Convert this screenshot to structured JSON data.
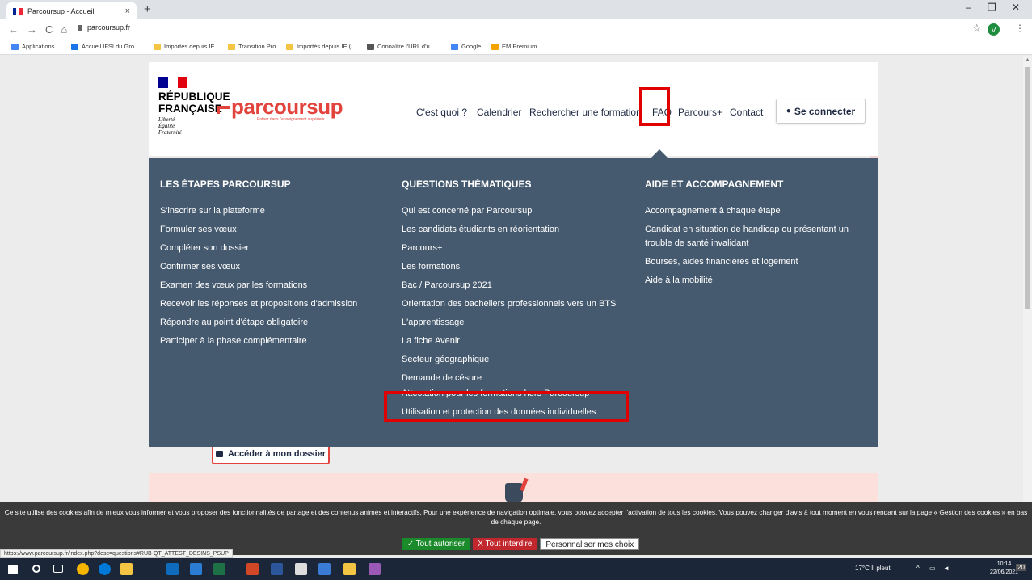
{
  "browser": {
    "tab_title": "Parcoursup - Accueil",
    "tab_close": "×",
    "new_tab": "+",
    "url": "parcoursup.fr",
    "avatar_initial": "V",
    "window_controls": [
      "–",
      "❐",
      "✕"
    ],
    "bookmarks": [
      "Applications",
      "Accueil IFSI du Gro...",
      "Importés depuis IE",
      "Transition Pro",
      "Importés depuis IE (...",
      "Connaître l'URL d'u...",
      "Google",
      "EM Premium"
    ],
    "bookmark_colors": [
      "#4285f4",
      "#1a73e8",
      "#f4c542",
      "#f4c542",
      "#f4c542",
      "#555555",
      "#4285f4",
      "#f4a300"
    ],
    "status_url": "https://www.parcoursup.fr/index.php?desc=questions#RUB-QT_ATTEST_DESINS_PSUP"
  },
  "header": {
    "rf_line1": "RÉPUBLIQUE",
    "rf_line2": "FRANÇAISE",
    "motto": [
      "Liberté",
      "Égalité",
      "Fraternité"
    ],
    "logo_text": "parcoursup",
    "logo_tagline": "Entrez dans l'enseignement supérieur",
    "nav": [
      "C'est quoi ?",
      "Calendrier",
      "Rechercher une formation",
      "FAQ",
      "Parcours+",
      "Contact"
    ],
    "connect_label": "Se connecter"
  },
  "mega_menu": {
    "columns": [
      {
        "title": "LES ÉTAPES PARCOURSUP",
        "links": [
          "S'inscrire sur la plateforme",
          "Formuler ses vœux",
          "Compléter son dossier",
          "Confirmer ses vœux",
          "Examen des vœux par les formations",
          "Recevoir les réponses et propositions d'admission",
          "Répondre au point d'étape obligatoire",
          "Participer à la phase complémentaire"
        ]
      },
      {
        "title": "QUESTIONS THÉMATIQUES",
        "links": [
          "Qui est concerné par Parcoursup",
          "Les candidats étudiants en réorientation",
          "Parcours+",
          "Les formations",
          "Bac / Parcoursup 2021",
          "Orientation des bacheliers professionnels vers un BTS",
          "L'apprentissage",
          "La fiche Avenir",
          "Secteur géographique",
          "Demande de césure",
          "Attestation pour les formations hors Parcoursup",
          "Utilisation et protection des données individuelles"
        ]
      },
      {
        "title": "AIDE ET ACCOMPAGNEMENT",
        "links": [
          "Accompagnement à chaque étape",
          "Candidat en situation de handicap ou présentant un trouble de santé invalidant",
          "Bourses, aides financières et logement",
          "Aide à la mobilité"
        ]
      }
    ]
  },
  "page": {
    "access_button": "Accéder à mon dossier"
  },
  "cookie": {
    "text": "Ce site utilise des cookies afin de mieux vous informer et vous proposer des fonctionnalités de partage et des contenus animés et interactifs. Pour une expérience de navigation optimale, vous pouvez accepter l'activation de tous les cookies. Vous pouvez changer d'avis à tout moment en vous rendant sur la page « Gestion des cookies » en bas de chaque page.",
    "accept": "✓ Tout autoriser",
    "deny": "X Tout interdire",
    "customize": "Personnaliser mes choix"
  },
  "taskbar": {
    "weather": "17°C Il pleut",
    "time": "10:14",
    "date": "22/06/2021",
    "notifications": "20",
    "app_colors": [
      "#ffffff",
      "#ffffff",
      "#ffffff",
      "#f4b400",
      "#0078d7",
      "#f4c542",
      "#0f6cbd",
      "#2b7cd3",
      "#1e7145",
      "#d24726",
      "#2b579a",
      "#dddddd",
      "#3a7bd5",
      "#f4c542",
      "#9b59b6"
    ]
  }
}
